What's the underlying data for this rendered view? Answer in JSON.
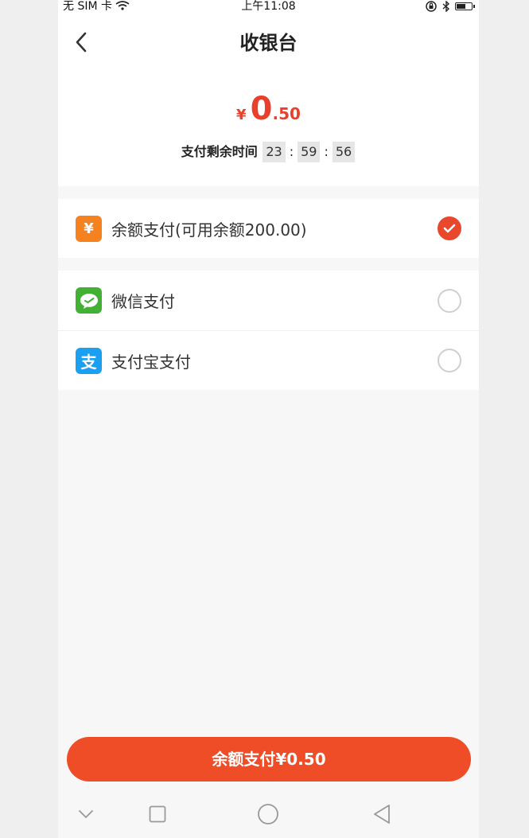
{
  "status_bar": {
    "carrier": "无 SIM 卡",
    "time": "上午11:08"
  },
  "header": {
    "title": "收银台",
    "currency_symbol": "¥",
    "amount_integer": "0",
    "amount_decimal": ".50",
    "countdown_label": "支付剩余时间",
    "countdown": {
      "hours": "23",
      "minutes": "59",
      "seconds": "56"
    }
  },
  "payment_methods": [
    {
      "label": "余额支付(可用余额200.00)",
      "icon": "balance-yen-icon",
      "icon_glyph": "¥",
      "icon_color": "#f5821f",
      "selected": true
    },
    {
      "label": "微信支付",
      "icon": "wechat-icon",
      "icon_color": "#41b035",
      "selected": false
    },
    {
      "label": "支付宝支付",
      "icon": "alipay-icon",
      "icon_glyph": "支",
      "icon_color": "#1a9ff1",
      "selected": false
    }
  ],
  "pay_button": {
    "label": "余额支付¥0.50"
  },
  "colors": {
    "accent": "#ee4d27",
    "price": "#e8402b",
    "background": "#f7f7f7"
  }
}
